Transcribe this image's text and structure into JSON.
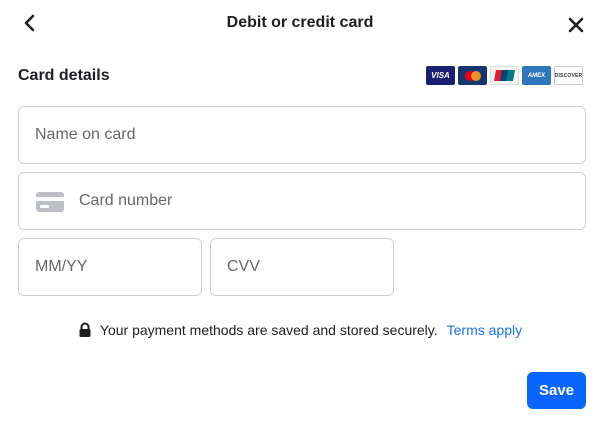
{
  "header": {
    "title": "Debit or credit card",
    "back_icon": "chevron-left-icon",
    "close_icon": "close-icon"
  },
  "card_details": {
    "section_title": "Card details",
    "accepted_cards": [
      {
        "name": "visa",
        "label": "VISA"
      },
      {
        "name": "mastercard",
        "label": ""
      },
      {
        "name": "unionpay",
        "label": "UnionPay"
      },
      {
        "name": "amex",
        "label": "AMEX"
      },
      {
        "name": "discover",
        "label": "DISCOVER"
      }
    ]
  },
  "form": {
    "name_on_card": {
      "placeholder": "Name on card",
      "value": ""
    },
    "card_number": {
      "placeholder": "Card number",
      "value": "",
      "icon": "credit-card-icon"
    },
    "expiry": {
      "placeholder": "MM/YY",
      "value": ""
    },
    "cvv": {
      "placeholder": "CVV",
      "value": ""
    }
  },
  "security": {
    "icon": "lock-icon",
    "message": "Your payment methods are saved and stored securely.",
    "link_label": "Terms apply"
  },
  "actions": {
    "save_label": "Save"
  },
  "colors": {
    "primary": "#0866ff",
    "link": "#1b74e4",
    "border": "#ccd0d5",
    "placeholder": "#65676b",
    "text": "#1c1e21"
  }
}
